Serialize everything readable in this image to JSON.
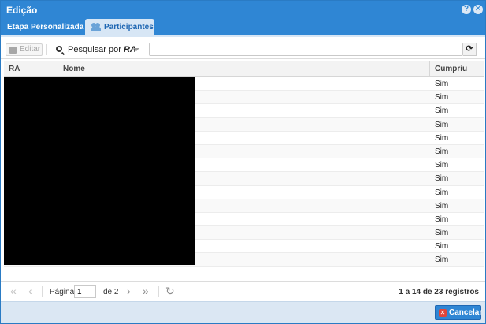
{
  "window": {
    "title": "Edição"
  },
  "tabs": [
    {
      "label": "Etapa Personalizada"
    },
    {
      "label": "Participantes"
    }
  ],
  "toolbar": {
    "edit_label": "Editar",
    "search_prefix": "Pesquisar por",
    "search_field": "RA",
    "search_value": ""
  },
  "grid": {
    "columns": {
      "ra": "RA",
      "nome": "Nome",
      "cumpriu": "Cumpriu"
    },
    "rows": [
      {
        "cumpriu": "Sim"
      },
      {
        "cumpriu": "Sim"
      },
      {
        "cumpriu": "Sim"
      },
      {
        "cumpriu": "Sim"
      },
      {
        "cumpriu": "Sim"
      },
      {
        "cumpriu": "Sim"
      },
      {
        "cumpriu": "Sim"
      },
      {
        "cumpriu": "Sim"
      },
      {
        "cumpriu": "Sim"
      },
      {
        "cumpriu": "Sim"
      },
      {
        "cumpriu": "Sim"
      },
      {
        "cumpriu": "Sim"
      },
      {
        "cumpriu": "Sim"
      },
      {
        "cumpriu": "Sim"
      }
    ]
  },
  "pager": {
    "page_label": "Página",
    "page_value": "1",
    "of_label": "de 2",
    "status": "1 a 14 de 23 registros"
  },
  "footer": {
    "cancel_label": "Cancelar"
  },
  "colors": {
    "accent": "#2f86d4",
    "danger": "#e0453a"
  },
  "icons": {
    "help": "help-icon",
    "close": "close-icon",
    "people": "people-icon",
    "search": "search-icon",
    "refresh": "refresh-icon"
  }
}
